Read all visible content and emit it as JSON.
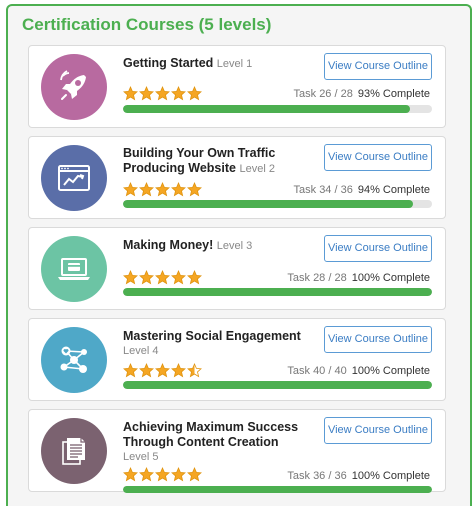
{
  "panel": {
    "title": "Certification Courses (5 levels)"
  },
  "colors": {
    "accent": "#4caf50",
    "link": "#3b7dc4",
    "star": "#f5a623"
  },
  "courses": [
    {
      "title": "Getting Started",
      "level": "Level 1",
      "button": "View Course Outline",
      "task": "Task 26 / 28",
      "percent_text": "93% Complete",
      "progress": 0.93,
      "rating": 5,
      "icon": "rocket-icon",
      "badge_color": "#b86aa0"
    },
    {
      "title": "Building Your Own Traffic Producing Website",
      "level": "Level 2",
      "button": "View Course Outline",
      "task": "Task 34 / 36",
      "percent_text": "94% Complete",
      "progress": 0.94,
      "rating": 5,
      "icon": "browser-chart-icon",
      "badge_color": "#5a6ea8"
    },
    {
      "title": "Making Money!",
      "level": "Level 3",
      "button": "View Course Outline",
      "task": "Task 28 / 28",
      "percent_text": "100% Complete",
      "progress": 1.0,
      "rating": 5,
      "icon": "laptop-card-icon",
      "badge_color": "#6cc4a4"
    },
    {
      "title": "Mastering Social Engagement",
      "level": "Level 4",
      "button": "View Course Outline",
      "task": "Task 40 / 40",
      "percent_text": "100% Complete",
      "progress": 1.0,
      "rating": 4.5,
      "icon": "social-network-icon",
      "badge_color": "#4fa8c8"
    },
    {
      "title": "Achieving Maximum Success Through Content Creation",
      "level": "Level 5",
      "button": "View Course Outline",
      "task": "Task 36 / 36",
      "percent_text": "100% Complete",
      "progress": 1.0,
      "rating": 5,
      "icon": "documents-icon",
      "badge_color": "#7b6270"
    }
  ]
}
